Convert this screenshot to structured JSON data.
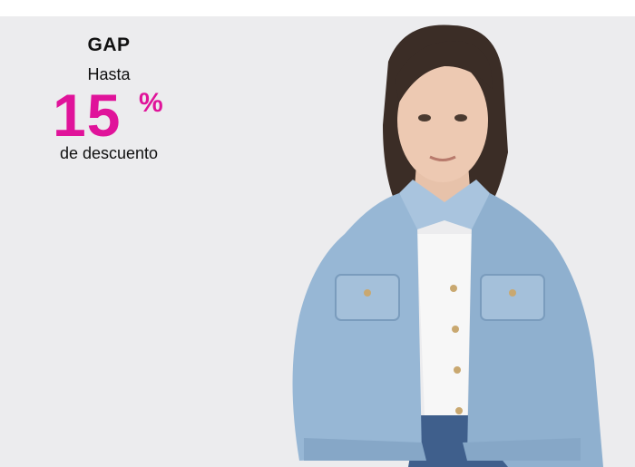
{
  "promo": {
    "brand": "GAP",
    "prefix": "Hasta",
    "value": "15",
    "percent_sign": "%",
    "suffix": "de descuento",
    "accent_color": "#e0139a"
  },
  "image": {
    "icon": "model-denim-jacket-photo"
  }
}
